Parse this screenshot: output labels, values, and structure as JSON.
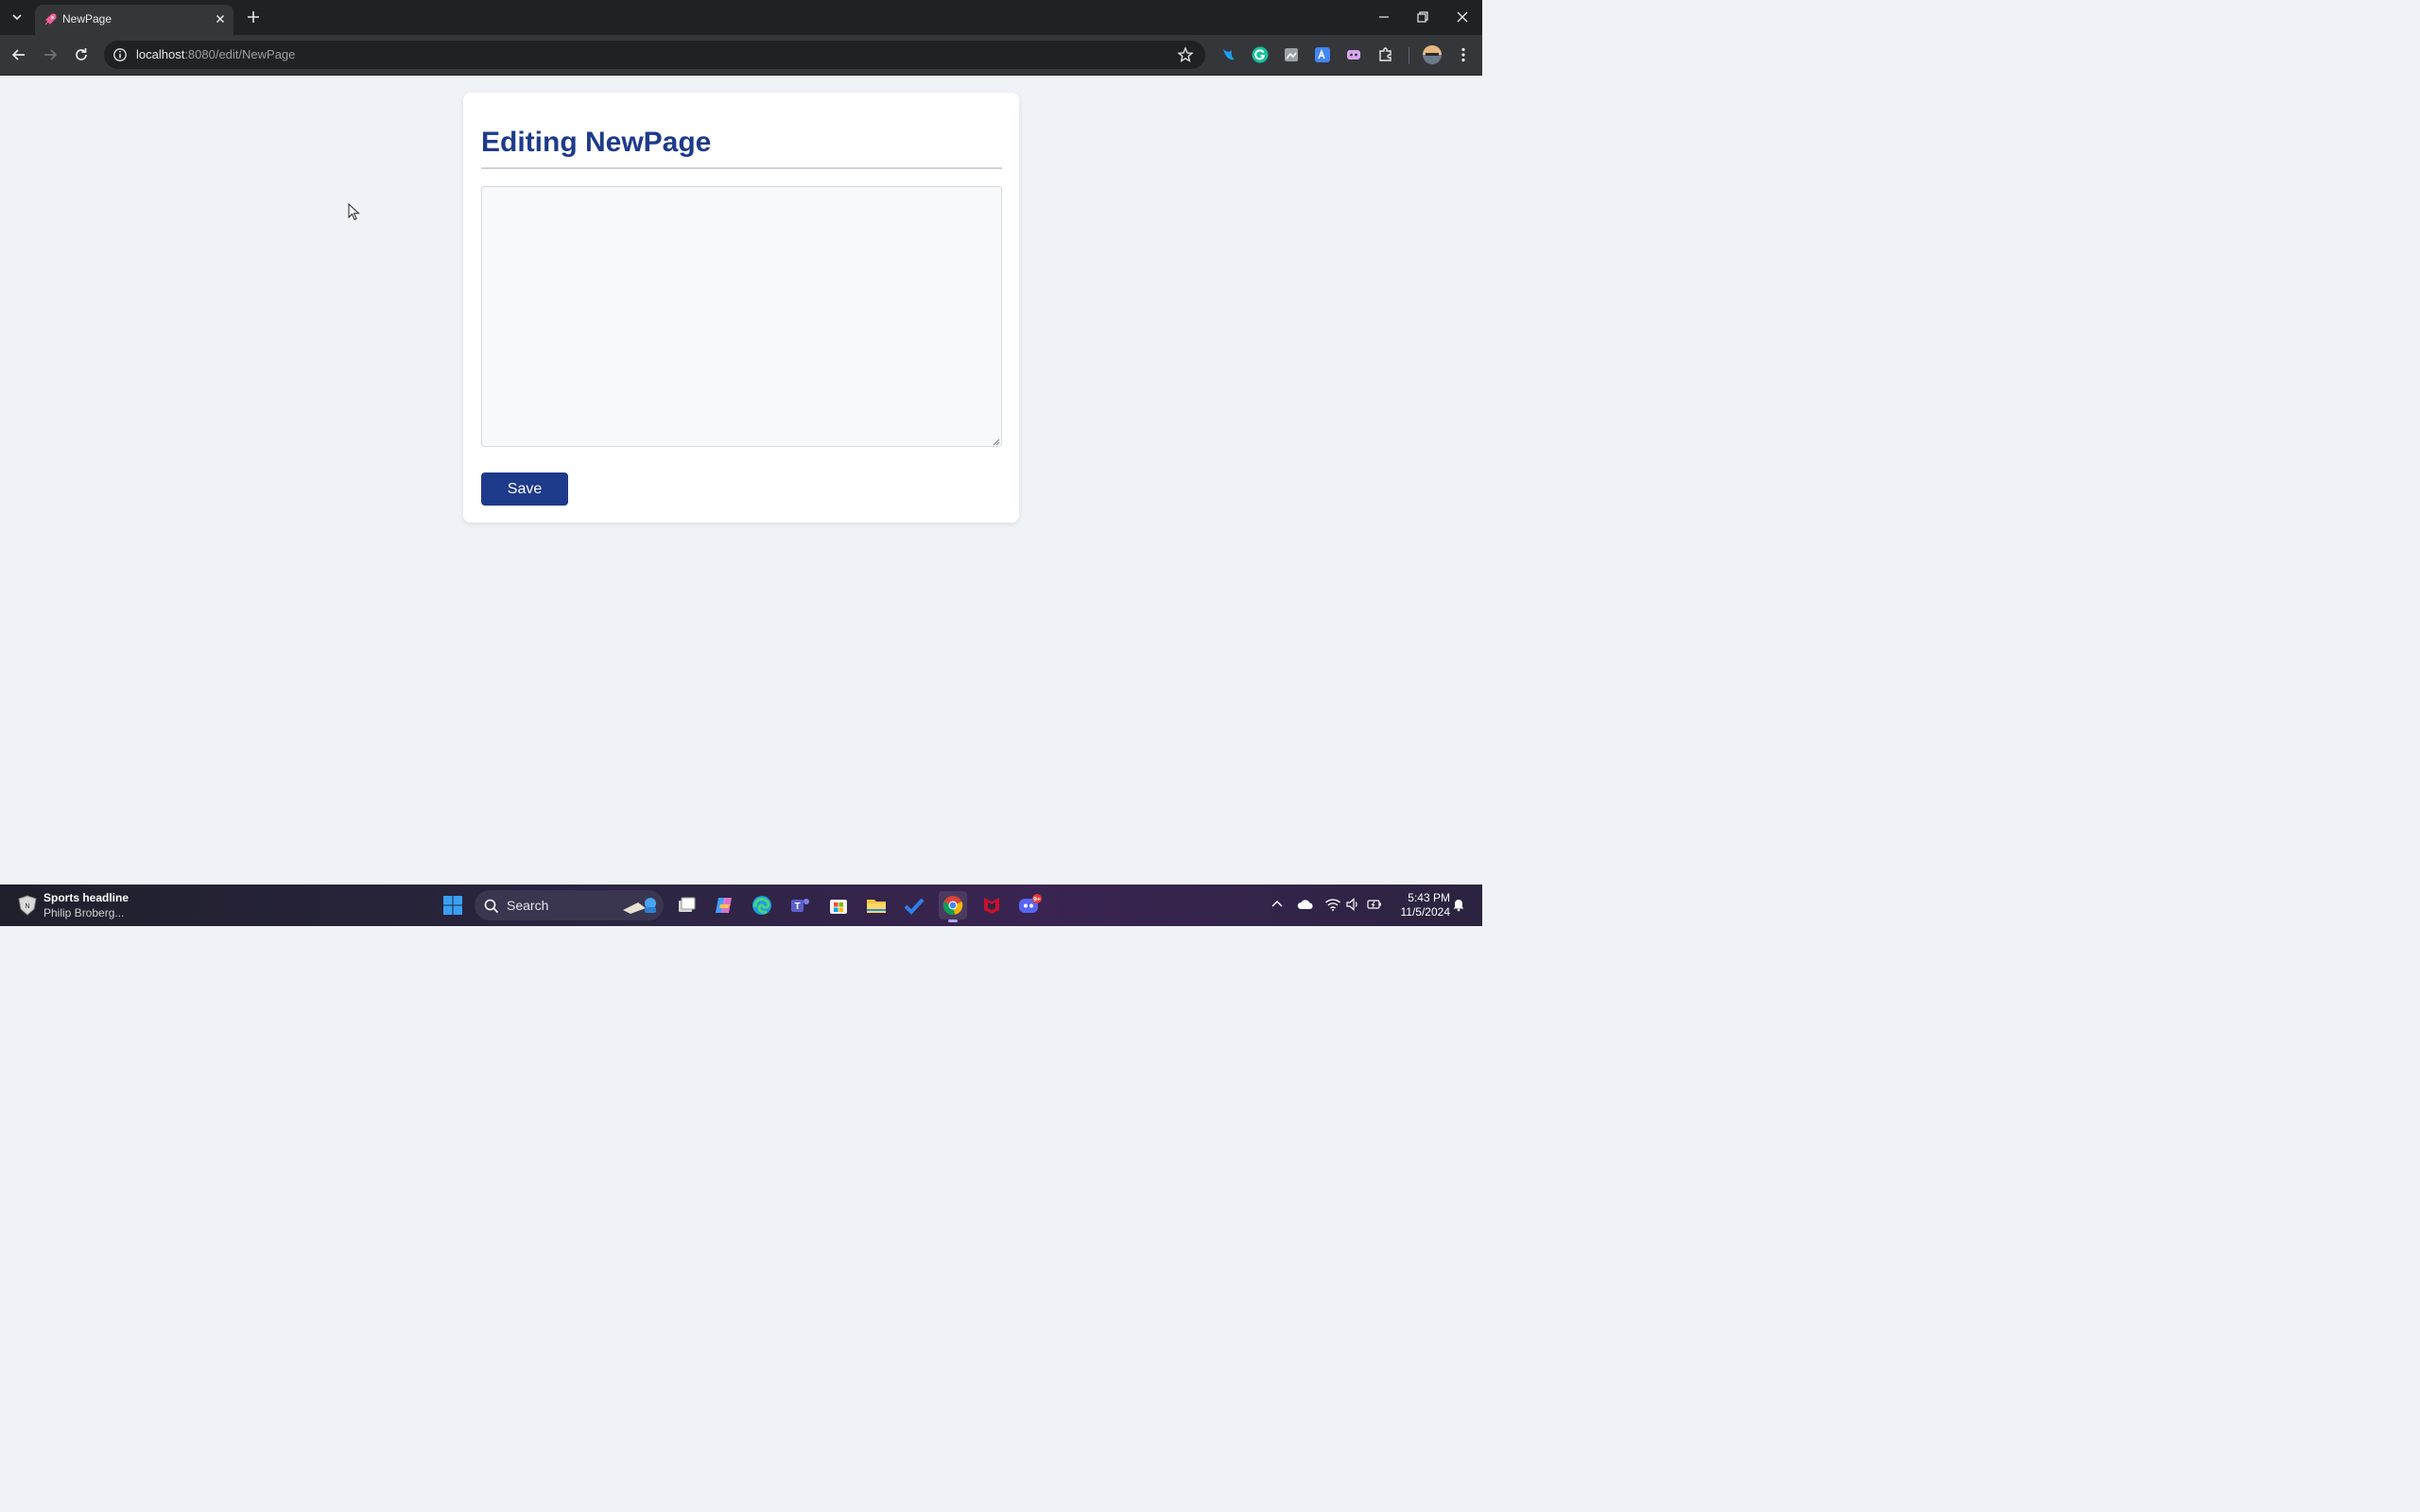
{
  "browser": {
    "tab": {
      "title": "NewPage",
      "favicon": "rocket-icon"
    },
    "address": {
      "host": "localhost",
      "path": ":8080/edit/NewPage"
    },
    "extensions": [
      "bird-extension-icon",
      "grammarly-icon",
      "puzzle-image-icon",
      "translate-icon",
      "discord-ext-icon",
      "extensions-puzzle-icon"
    ]
  },
  "page": {
    "heading": "Editing NewPage",
    "editor_value": "",
    "save_label": "Save",
    "colors": {
      "heading": "#1e3a8a",
      "button": "#1e3a8a",
      "background": "#eff2f7"
    }
  },
  "taskbar": {
    "news": {
      "title": "Sports headline",
      "subtitle": "Philip Broberg..."
    },
    "search_placeholder": "Search",
    "apps": [
      "file-explorer-icon",
      "copilot-icon",
      "edge-icon",
      "teams-icon",
      "store-icon",
      "folder-icon",
      "todo-icon",
      "chrome-icon",
      "mcafee-icon",
      "discord-icon"
    ],
    "discord_badge": "9+",
    "time": "5:43 PM",
    "date": "11/5/2024"
  }
}
